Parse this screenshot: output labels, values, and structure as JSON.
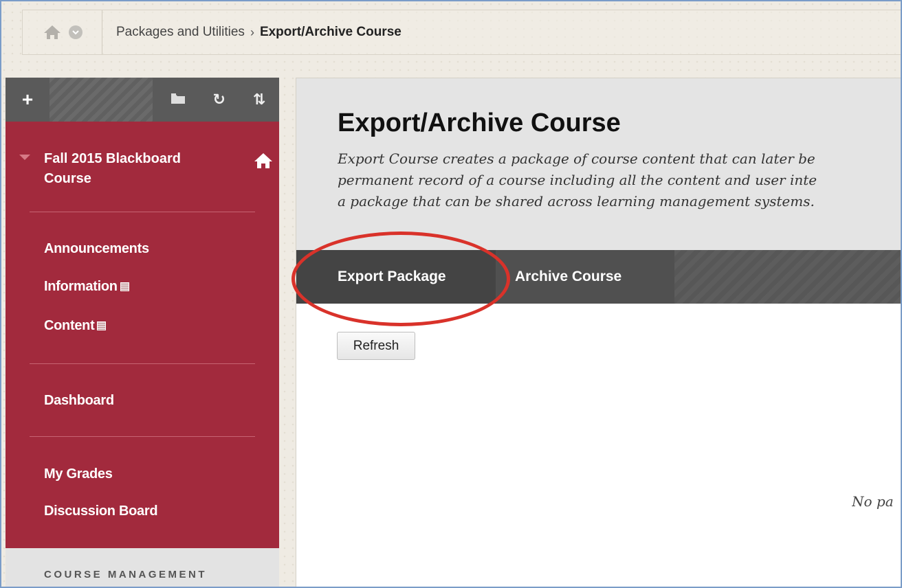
{
  "breadcrumb": {
    "parent": "Packages and Utilities",
    "separator": "›",
    "current": "Export/Archive Course"
  },
  "sidebar": {
    "course_title_line1": "Fall 2015 Blackboard",
    "course_title_line2": "Course",
    "items": [
      {
        "label": "Announcements"
      },
      {
        "label": "Information"
      },
      {
        "label": "Content"
      },
      {
        "label": "Dashboard"
      },
      {
        "label": "My Grades"
      },
      {
        "label": "Discussion Board"
      }
    ],
    "management_label": "COURSE MANAGEMENT"
  },
  "main": {
    "title": "Export/Archive Course",
    "description_lines": [
      "Export Course creates a package of course content that can later be",
      "permanent record of a course including all the content and user inte",
      "a package that can be shared across learning management systems."
    ],
    "tabs": [
      {
        "label": "Export Package",
        "active": true
      },
      {
        "label": "Archive Course",
        "active": false
      }
    ],
    "refresh_label": "Refresh",
    "empty_message": "No pa"
  },
  "colors": {
    "sidebar_bg": "#a22a3d",
    "tab_bar": "#505050",
    "highlight_ring": "#d9322a"
  }
}
